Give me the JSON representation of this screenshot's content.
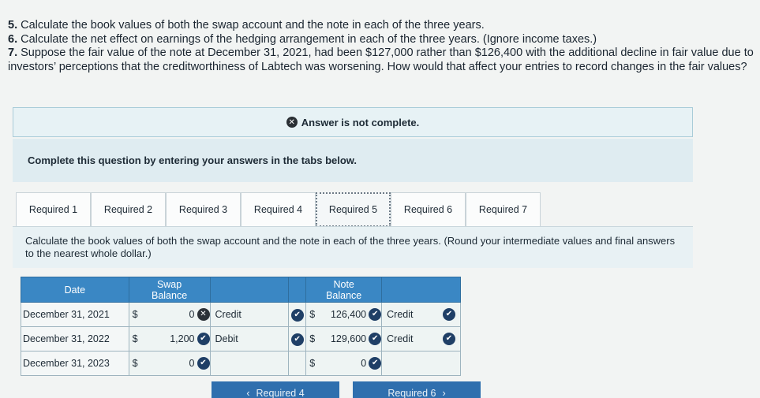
{
  "question": {
    "q5_num": "5.",
    "q5_text": "Calculate the book values of both the swap account and the note in each of the three years.",
    "q6_num": "6.",
    "q6_text": "Calculate the net effect on earnings of the hedging arrangement in each of the three years. (Ignore income taxes.)",
    "q7_num": "7.",
    "q7_text": "Suppose the fair value of the note at December 31, 2021, had been $127,000 rather than $126,400 with the additional decline in fair value due to investors’ perceptions that the creditworthiness of Labtech was worsening. How would that affect your entries to record changes in the fair values?"
  },
  "banner": {
    "text": "Answer is not complete."
  },
  "instruction": "Complete this question by entering your answers in the tabs below.",
  "tabs": [
    "Required 1",
    "Required 2",
    "Required 3",
    "Required 4",
    "Required 5",
    "Required 6",
    "Required 7"
  ],
  "active_tab": "Required 5",
  "panel_text": "Calculate the book values of both the swap account and the note in each of the three years. (Round your intermediate values and final answers to the nearest whole dollar.)",
  "table": {
    "headers": {
      "date": "Date",
      "swap": "Swap Balance",
      "note": "Note Balance"
    },
    "rows": [
      {
        "date": "December 31, 2021",
        "swap_cur": "$",
        "swap_amt": "0",
        "swap_status": "incorrect",
        "swap_type": "Credit",
        "note_cur": "$",
        "note_amt": "126,400",
        "note_type": "Credit"
      },
      {
        "date": "December 31, 2022",
        "swap_cur": "$",
        "swap_amt": "1,200",
        "swap_status": "correct",
        "swap_type": "Debit",
        "note_cur": "$",
        "note_amt": "129,600",
        "note_type": "Credit"
      },
      {
        "date": "December 31, 2023",
        "swap_cur": "$",
        "swap_amt": "0",
        "swap_status": "correct",
        "swap_type": "",
        "note_cur": "$",
        "note_amt": "0",
        "note_type": ""
      }
    ]
  },
  "nav": {
    "prev": "Required 4",
    "next": "Required 6"
  },
  "colors": {
    "header_blue": "#3a87c4",
    "check_navy": "#1f3f66",
    "nav_blue": "#2f6fae"
  }
}
